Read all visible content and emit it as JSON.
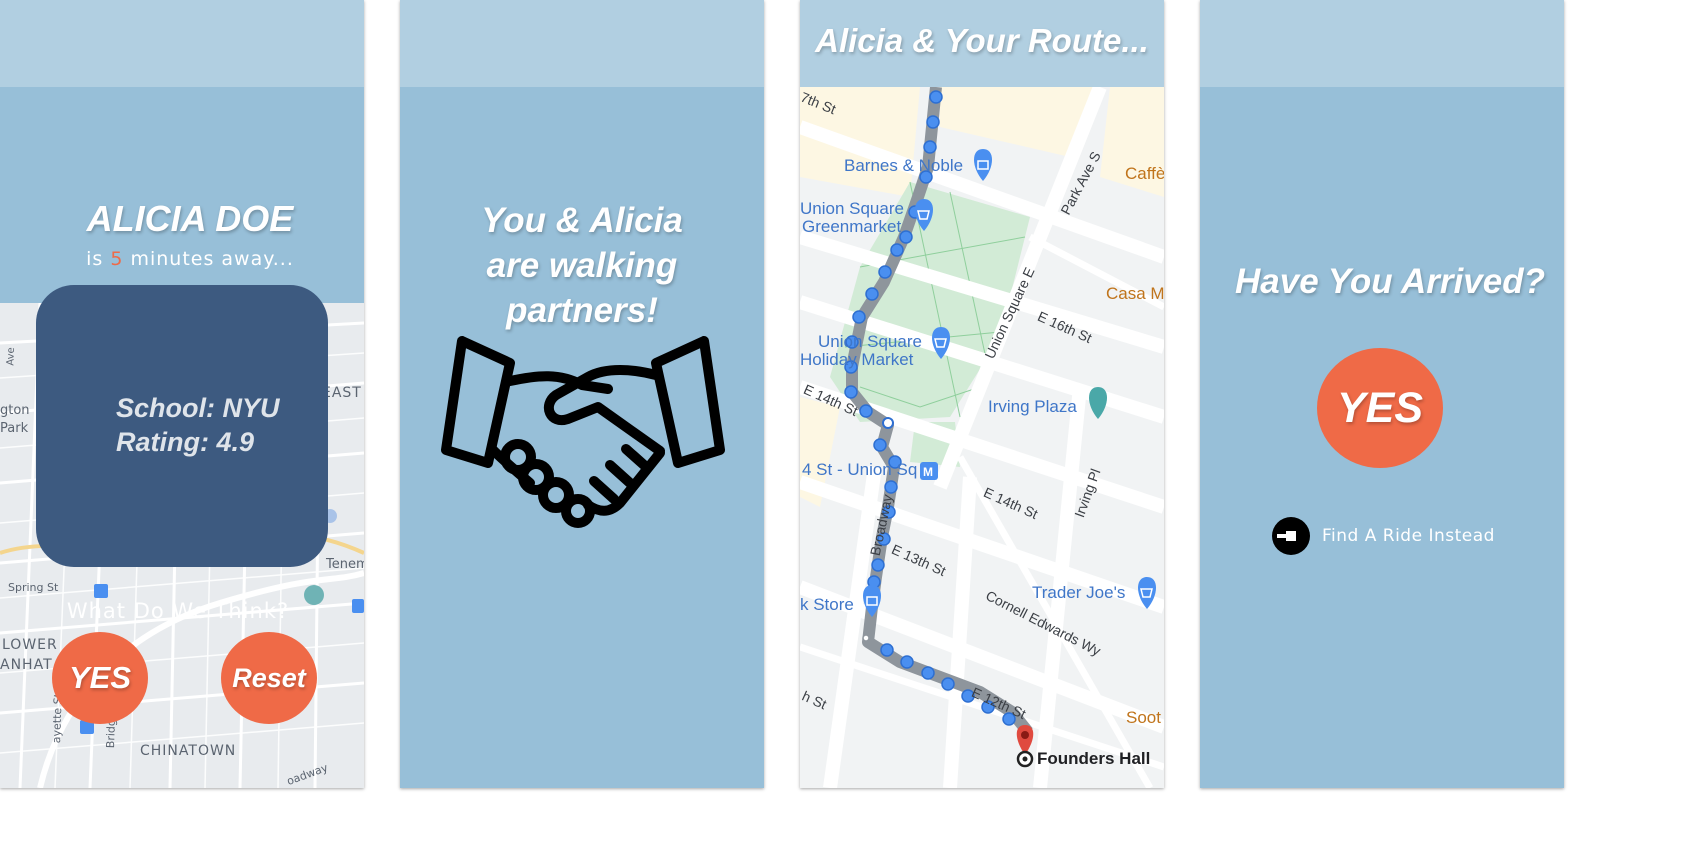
{
  "screen1": {
    "name": "ALICIA DOE",
    "away_prefix": "is ",
    "away_minutes": "5",
    "away_suffix": " minutes away...",
    "school": "School: NYU",
    "rating": "Rating: 4.9",
    "prompt": "What Do We Think?",
    "yes_label": "YES",
    "reset_label": "Reset",
    "map_labels": [
      "EAST",
      "gton",
      "Park",
      "Tenemer",
      "Spring St",
      "LOWER",
      "ANHAT",
      "CHINATOWN",
      "ayette St",
      "Bridge St",
      "oadway",
      "Ave"
    ]
  },
  "screen2": {
    "lines": [
      "You & Alicia",
      "are walking",
      "partners!"
    ],
    "icon": "handshake-icon"
  },
  "screen3": {
    "title": "Alicia & Your Route...",
    "pois": {
      "barnes": "Barnes & Noble",
      "greenmarket": [
        "Union Square",
        "Greenmarket"
      ],
      "holiday": [
        "Union Square",
        "Holiday Market"
      ],
      "irving": "Irving Plaza",
      "subway": "4 St - Union Sq",
      "traders": "Trader Joe's",
      "kstore": "k Store",
      "founders": "Founders Hall",
      "caffe": "Caffè",
      "casa": "Casa M",
      "soot": "Soot"
    },
    "streets": {
      "s7th": "7th St",
      "parkave": "Park Ave S",
      "unionsqe": "Union Square E",
      "e16": "E 16th St",
      "e14a": "E 14th St",
      "e14b": "E 14th St",
      "irvingpl": "Irving Pl",
      "broadway": "Broadway",
      "e13": "E 13th St",
      "cornell": "Cornell Edwards Wy",
      "e12": "E 12th St",
      "hst": "h St"
    }
  },
  "screen4": {
    "title": "Have You Arrived?",
    "yes_label": "YES",
    "ride_label": "Find A Ride Instead"
  },
  "colors": {
    "screen_bg": "#97bfd8",
    "top_bar": "#b1cfe1",
    "accent": "#ef6a47",
    "card": "#3d5a80",
    "route_blue": "#4a8ff0"
  }
}
